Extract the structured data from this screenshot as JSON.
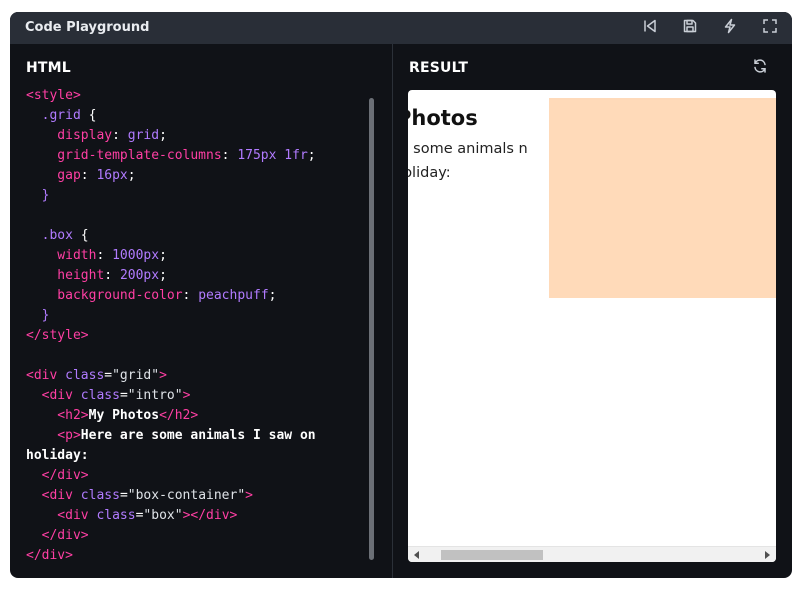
{
  "app": {
    "title": "Code Playground"
  },
  "toolbar": {
    "icons": [
      "skip-back-icon",
      "save-icon",
      "lightning-icon",
      "fullscreen-icon"
    ]
  },
  "editor": {
    "title": "HTML",
    "lines": [
      [
        [
          "tag",
          "<style>"
        ]
      ],
      [
        [
          "sel",
          "  .grid "
        ],
        [
          "punc",
          "{"
        ]
      ],
      [
        [
          "prop",
          "    display"
        ],
        [
          "punc",
          ": "
        ],
        [
          "kw",
          "grid"
        ],
        [
          "punc",
          ";"
        ]
      ],
      [
        [
          "prop",
          "    grid-template-columns"
        ],
        [
          "punc",
          ": "
        ],
        [
          "num",
          "175px 1fr"
        ],
        [
          "punc",
          ";"
        ]
      ],
      [
        [
          "prop",
          "    gap"
        ],
        [
          "punc",
          ": "
        ],
        [
          "num",
          "16px"
        ],
        [
          "punc",
          ";"
        ]
      ],
      [
        [
          "sel",
          "  }"
        ]
      ],
      [
        [
          "punc",
          " "
        ]
      ],
      [
        [
          "sel",
          "  .box "
        ],
        [
          "punc",
          "{"
        ]
      ],
      [
        [
          "prop",
          "    width"
        ],
        [
          "punc",
          ": "
        ],
        [
          "num",
          "1000px"
        ],
        [
          "punc",
          ";"
        ]
      ],
      [
        [
          "prop",
          "    height"
        ],
        [
          "punc",
          ": "
        ],
        [
          "num",
          "200px"
        ],
        [
          "punc",
          ";"
        ]
      ],
      [
        [
          "prop",
          "    background-color"
        ],
        [
          "punc",
          ": "
        ],
        [
          "kw",
          "peachpuff"
        ],
        [
          "punc",
          ";"
        ]
      ],
      [
        [
          "sel",
          "  }"
        ]
      ],
      [
        [
          "tag",
          "</style>"
        ]
      ],
      [
        [
          "punc",
          " "
        ]
      ],
      [
        [
          "tag",
          "<div "
        ],
        [
          "attr",
          "class"
        ],
        [
          "punc",
          "="
        ],
        [
          "val",
          "\"grid\""
        ],
        [
          "tag",
          ">"
        ]
      ],
      [
        [
          "tag",
          "  <div "
        ],
        [
          "attr",
          "class"
        ],
        [
          "punc",
          "="
        ],
        [
          "val",
          "\"intro\""
        ],
        [
          "tag",
          ">"
        ]
      ],
      [
        [
          "tag",
          "    <h2>"
        ],
        [
          "txt",
          "My Photos"
        ],
        [
          "tag",
          "</h2>"
        ]
      ],
      [
        [
          "tag",
          "    <p>"
        ],
        [
          "txt",
          "Here are some animals I saw on"
        ]
      ],
      [
        [
          "txt",
          "holiday:"
        ]
      ],
      [
        [
          "tag",
          "  </div>"
        ]
      ],
      [
        [
          "tag",
          "  <div "
        ],
        [
          "attr",
          "class"
        ],
        [
          "punc",
          "="
        ],
        [
          "val",
          "\"box-container\""
        ],
        [
          "tag",
          ">"
        ]
      ],
      [
        [
          "tag",
          "    <div "
        ],
        [
          "attr",
          "class"
        ],
        [
          "punc",
          "="
        ],
        [
          "val",
          "\"box\""
        ],
        [
          "tag",
          "></div>"
        ]
      ],
      [
        [
          "tag",
          "  </div>"
        ]
      ],
      [
        [
          "tag",
          "</div>"
        ]
      ]
    ]
  },
  "result": {
    "title": "RESULT",
    "heading": "Photos",
    "paragraph": "re some animals n holiday:",
    "box_color": "#ffdab9"
  },
  "colors": {
    "panel": "#101217",
    "titlebar": "#292e37",
    "tag": "#ff3fa4",
    "keyword": "#b17bff"
  }
}
